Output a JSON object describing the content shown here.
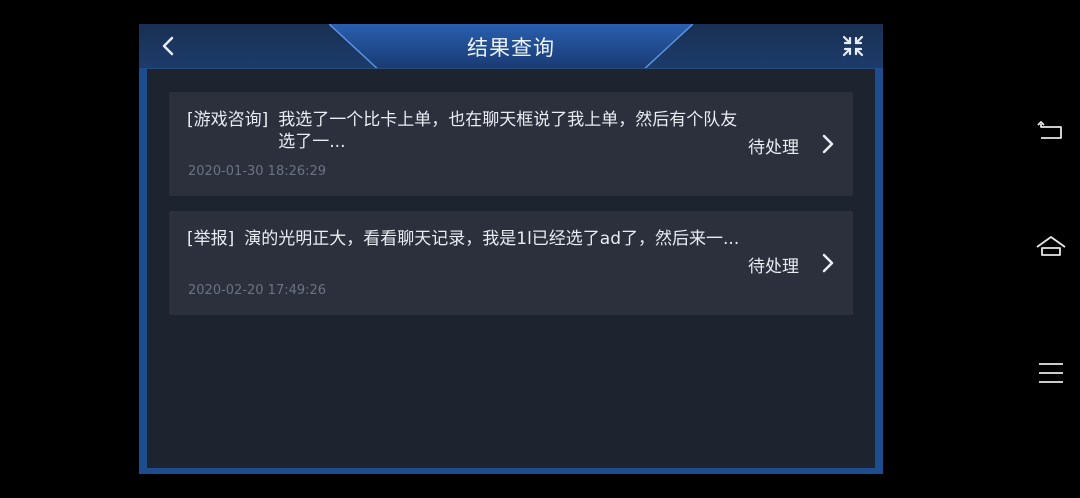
{
  "header": {
    "title": "结果查询",
    "back_icon": "chevron-left-icon",
    "close_icon": "collapse-x-icon"
  },
  "tickets": [
    {
      "category": "[游戏咨询]",
      "summary": "我选了一个比卡上单，也在聊天框说了我上单，然后有个队友选了一...",
      "time": "2020-01-30 18:26:29",
      "status": "待处理"
    },
    {
      "category": "[举报]",
      "summary": "演的光明正大，看看聊天记录，我是1l已经选了ad了，然后来一...",
      "time": "2020-02-20 17:49:26",
      "status": "待处理"
    }
  ],
  "navbar": {
    "back_icon": "nav-back-icon",
    "home_icon": "nav-home-icon",
    "menu_icon": "nav-menu-icon"
  },
  "colors": {
    "panel_border": "#1d4d8e",
    "header_bg": "#1c3c6c",
    "body_bg": "#1d2430",
    "card_bg": "#2b303c",
    "text_primary": "#e9ecf2",
    "text_muted": "#6b7283"
  }
}
